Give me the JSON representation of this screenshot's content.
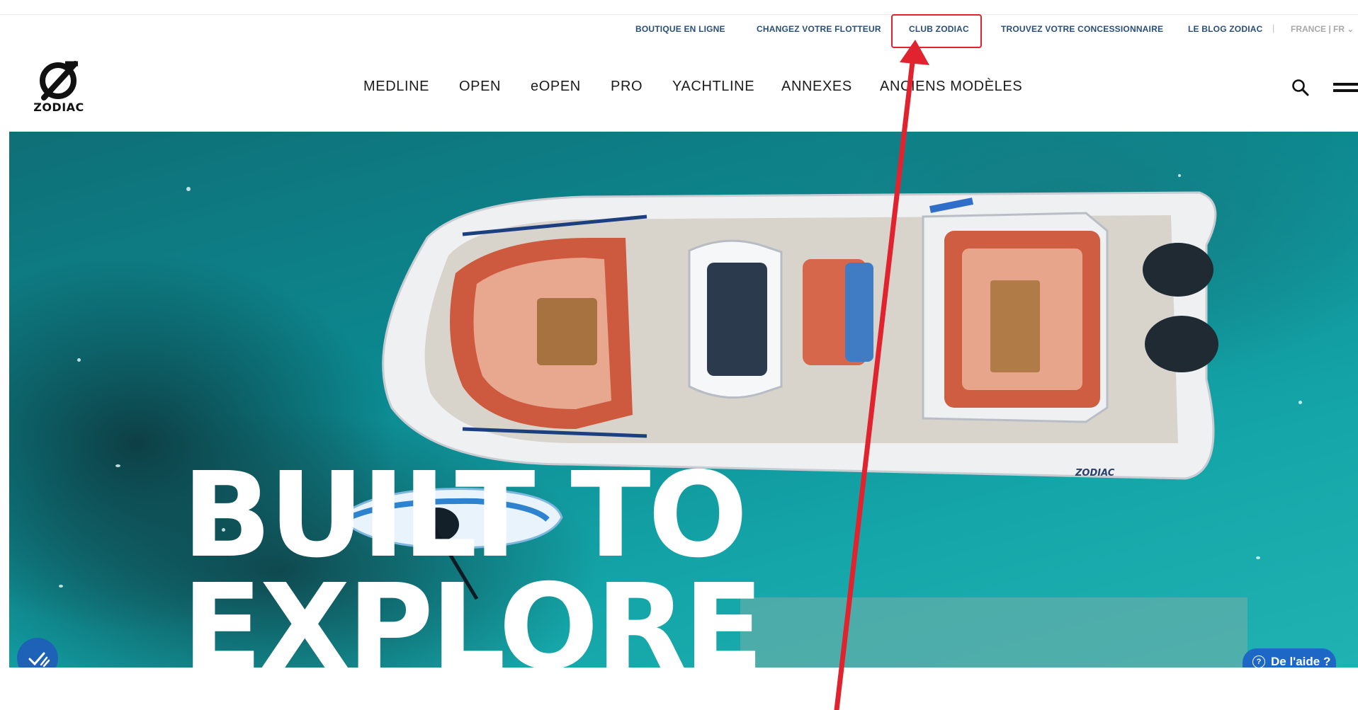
{
  "utility_bar": {
    "links": [
      "BOUTIQUE EN LIGNE",
      "CHANGEZ VOTRE FLOTTEUR",
      "CLUB ZODIAC",
      "TROUVEZ VOTRE CONCESSIONNAIRE",
      "LE BLOG ZODIAC"
    ],
    "separator": "|",
    "locale": "FRANCE | FR ⌄"
  },
  "header": {
    "logo_text": "ZODIAC",
    "nav": [
      "MEDLINE",
      "OPEN",
      "eOPEN",
      "PRO",
      "YACHTLINE",
      "ANNEXES",
      "ANCIENS MODÈLES"
    ],
    "search_icon": "search-icon",
    "menu_icon": "hamburger-menu-icon"
  },
  "hero": {
    "title_line1": "BUILT TO",
    "title_line2": "EXPLORE",
    "boat_brand": "ZODIAC",
    "help_label": "De l'aide ?",
    "accessibility_icon": "accessibility-icon"
  },
  "annotation": {
    "highlighted": "CLUB ZODIAC",
    "color": "#e0232e"
  }
}
